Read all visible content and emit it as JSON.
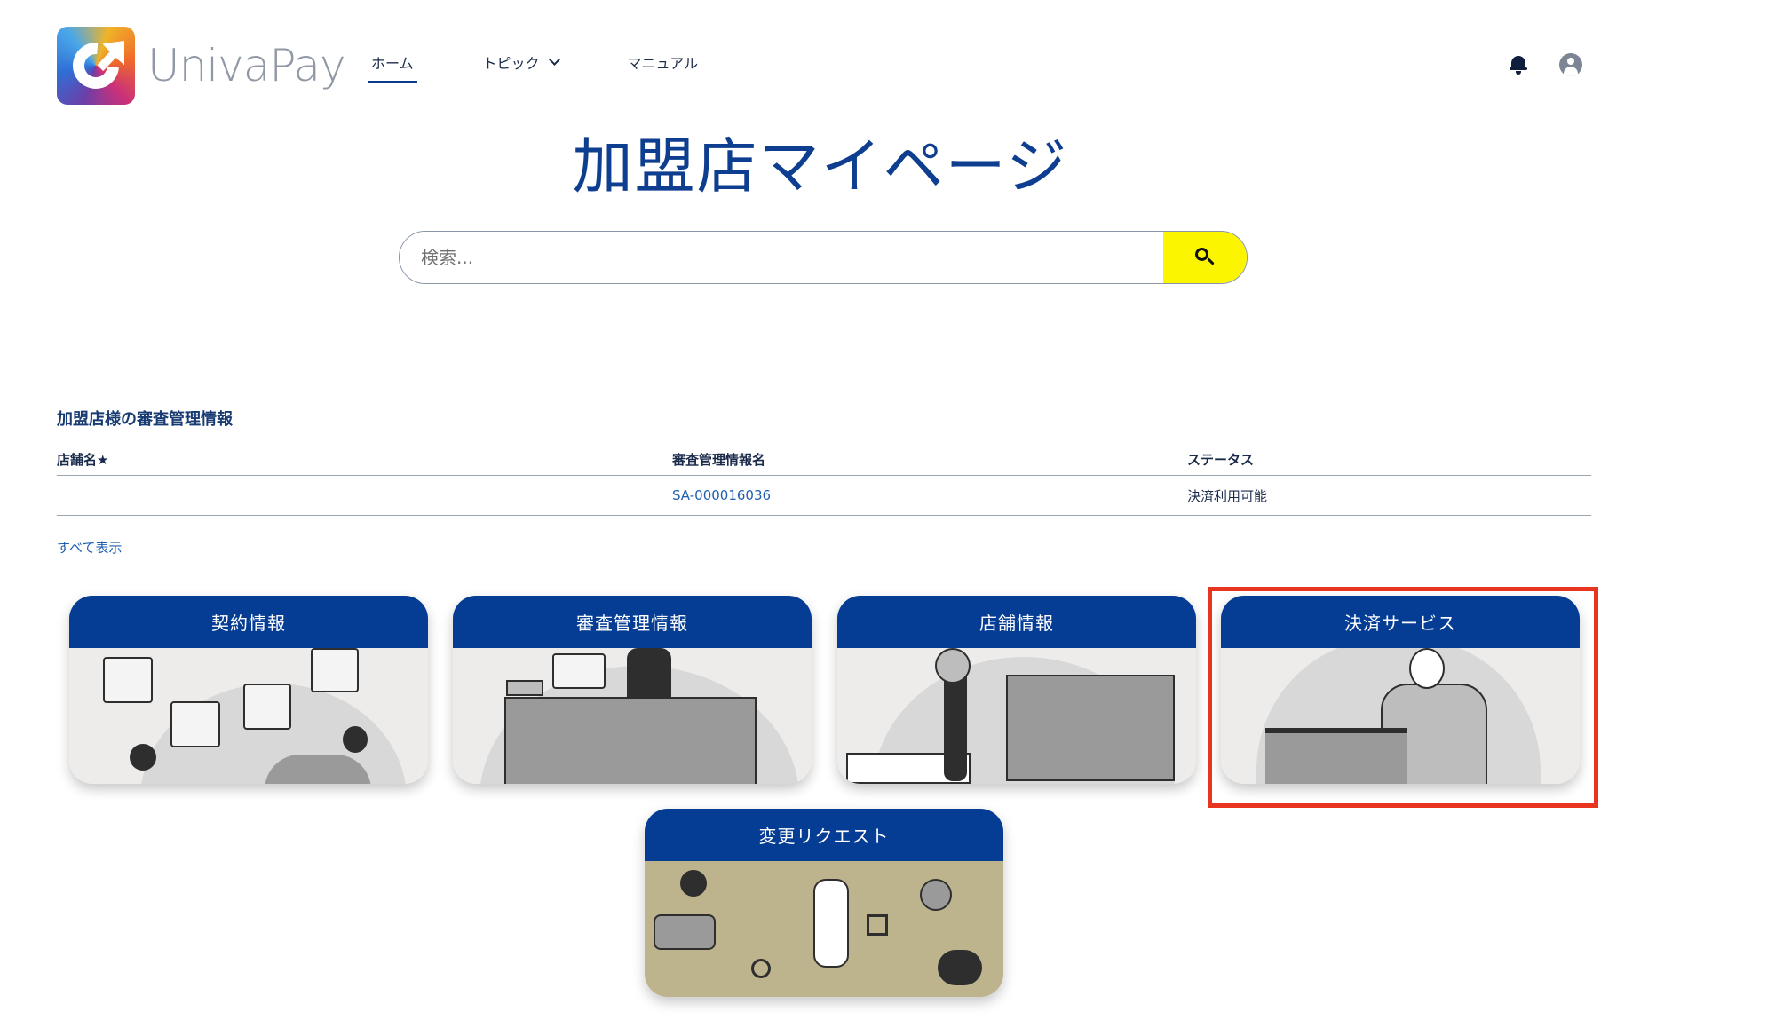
{
  "brand": {
    "name": "UnivaPay"
  },
  "nav": {
    "items": [
      {
        "label": "ホーム",
        "active": true
      },
      {
        "label": "トピック",
        "has_dropdown": true
      },
      {
        "label": "マニュアル"
      }
    ]
  },
  "header_icons": [
    "bell-icon",
    "user-avatar-icon"
  ],
  "page": {
    "title": "加盟店マイページ"
  },
  "search": {
    "placeholder": "検索...",
    "button_icon": "search-icon"
  },
  "review_section": {
    "title": "加盟店様の審査管理情報",
    "columns": [
      "店舗名★",
      "審査管理情報名",
      "ステータス"
    ],
    "rows": [
      {
        "store_name": "",
        "review_name": "SA-000016036",
        "status": "決済利用可能"
      }
    ],
    "view_all_label": "すべて表示"
  },
  "cards": [
    {
      "label": "契約情報"
    },
    {
      "label": "審査管理情報"
    },
    {
      "label": "店舗情報"
    },
    {
      "label": "決済サービス",
      "highlighted": true
    },
    {
      "label": "変更リクエスト"
    }
  ],
  "colors": {
    "title_blue": "#0e3e8f",
    "card_header": "#053c94",
    "search_button": "#fbf500",
    "highlight_border": "#e8351f"
  }
}
